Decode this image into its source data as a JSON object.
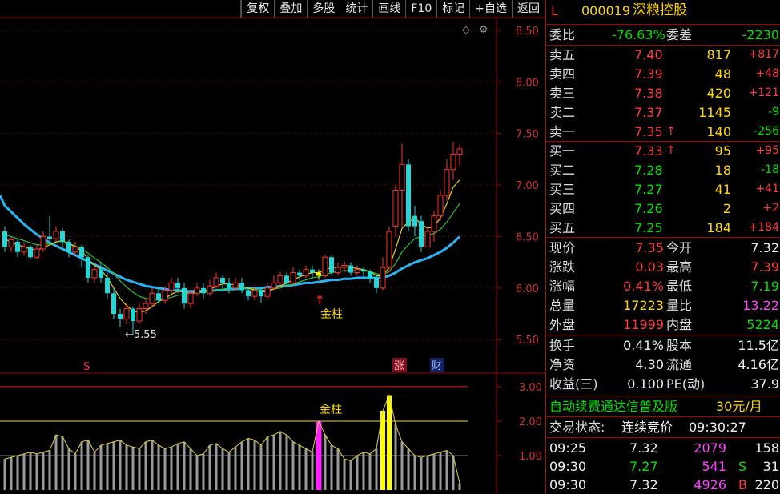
{
  "toolbar": [
    "复权",
    "叠加",
    "多股",
    "统计",
    "画线",
    "F10",
    "标记",
    "+自选",
    "返回"
  ],
  "stock": {
    "flag": "L",
    "code": "000019",
    "name": "深粮控股"
  },
  "webi": {
    "label": "委比",
    "value": "-76.63%",
    "label2": "委差",
    "value2": "-2230"
  },
  "sells": [
    {
      "label": "卖五",
      "price": "7.40",
      "vol": "817",
      "chg": "+817"
    },
    {
      "label": "卖四",
      "price": "7.39",
      "vol": "48",
      "chg": "+48"
    },
    {
      "label": "卖三",
      "price": "7.38",
      "vol": "420",
      "chg": "+121"
    },
    {
      "label": "卖二",
      "price": "7.37",
      "vol": "1145",
      "chg": "-9"
    },
    {
      "label": "卖一",
      "price": "7.35",
      "vol": "140",
      "chg": "-256",
      "arrow": "↑"
    }
  ],
  "buys": [
    {
      "label": "买一",
      "price": "7.33",
      "vol": "95",
      "chg": "+95",
      "arrow": "↑"
    },
    {
      "label": "买二",
      "price": "7.28",
      "vol": "18",
      "chg": "-18"
    },
    {
      "label": "买三",
      "price": "7.27",
      "vol": "41",
      "chg": "+41"
    },
    {
      "label": "买四",
      "price": "7.26",
      "vol": "2",
      "chg": "+2"
    },
    {
      "label": "买五",
      "price": "7.25",
      "vol": "184",
      "chg": "+184"
    }
  ],
  "quote": [
    {
      "l1": "现价",
      "v1": "7.35",
      "c1": "red",
      "l2": "今开",
      "v2": "7.32",
      "c2": "white"
    },
    {
      "l1": "涨跌",
      "v1": "0.03",
      "c1": "red",
      "l2": "最高",
      "v2": "7.39",
      "c2": "red"
    },
    {
      "l1": "涨幅",
      "v1": "0.41%",
      "c1": "red",
      "l2": "最低",
      "v2": "7.19",
      "c2": "green"
    },
    {
      "l1": "总量",
      "v1": "17223",
      "c1": "yellow",
      "l2": "量比",
      "v2": "13.22",
      "c2": "mag"
    },
    {
      "l1": "外盘",
      "v1": "11999",
      "c1": "red",
      "l2": "内盘",
      "v2": "5224",
      "c2": "green"
    }
  ],
  "fund": [
    {
      "l1": "换手",
      "v1": "0.41%",
      "l2": "股本",
      "v2": "11.5亿"
    },
    {
      "l1": "净资",
      "v1": "4.30",
      "l2": "流通",
      "v2": "4.16亿"
    },
    {
      "l1": "收益(三)",
      "v1": "0.100",
      "l2": "PE(动)",
      "v2": "37.9"
    }
  ],
  "ad": {
    "text": "自动续费通达信普及版",
    "price": "30元/月"
  },
  "trade_status": {
    "label": "交易状态:",
    "state": "连续竞价",
    "time": "09:30:27"
  },
  "ticks": [
    {
      "time": "09:25",
      "price": "7.32",
      "pc": "white",
      "vol": "2079",
      "flag": "",
      "tail": "158"
    },
    {
      "time": "09:30",
      "price": "7.27",
      "pc": "green",
      "vol": "541",
      "flag": "S",
      "tail": "31"
    },
    {
      "time": "09:30",
      "price": "7.32",
      "pc": "white",
      "vol": "4926",
      "flag": "B",
      "tail": "220"
    }
  ],
  "chart_labels": {
    "low_label": "←5.55",
    "gold1": "金柱",
    "gold2": "金柱",
    "s_mark": "S",
    "zhang": "涨",
    "cai": "财"
  },
  "price_axis": [
    "8.50",
    "8.00",
    "7.50",
    "7.00",
    "6.50",
    "6.00",
    "5.50"
  ],
  "ind_axis": [
    "3.00",
    "2.00",
    "1.00"
  ],
  "chart_data": {
    "type": "candlestick",
    "ylim": [
      5.3,
      8.6
    ],
    "candles": [
      [
        6.55,
        6.4,
        6.6,
        6.35
      ],
      [
        6.4,
        6.47,
        6.5,
        6.35
      ],
      [
        6.45,
        6.35,
        6.48,
        6.3
      ],
      [
        6.35,
        6.4,
        6.45,
        6.32
      ],
      [
        6.4,
        6.3,
        6.42,
        6.28
      ],
      [
        6.3,
        6.38,
        6.42,
        6.28
      ],
      [
        6.38,
        6.5,
        6.55,
        6.35
      ],
      [
        6.5,
        6.48,
        6.7,
        6.44
      ],
      [
        6.48,
        6.55,
        6.6,
        6.45
      ],
      [
        6.55,
        6.45,
        6.58,
        6.4
      ],
      [
        6.45,
        6.35,
        6.47,
        6.3
      ],
      [
        6.35,
        6.4,
        6.45,
        6.32
      ],
      [
        6.4,
        6.3,
        6.42,
        6.2
      ],
      [
        6.3,
        6.1,
        6.32,
        6.05
      ],
      [
        6.1,
        6.18,
        6.22,
        6.05
      ],
      [
        6.18,
        6.1,
        6.25,
        6.05
      ],
      [
        6.1,
        5.95,
        6.15,
        5.9
      ],
      [
        5.95,
        5.75,
        6.0,
        5.7
      ],
      [
        5.75,
        5.7,
        5.8,
        5.62
      ],
      [
        5.7,
        5.8,
        5.85,
        5.65
      ],
      [
        5.8,
        5.68,
        5.82,
        5.55
      ],
      [
        5.68,
        5.8,
        5.85,
        5.65
      ],
      [
        5.8,
        5.85,
        5.9,
        5.75
      ],
      [
        5.85,
        5.95,
        6.0,
        5.82
      ],
      [
        5.95,
        5.88,
        6.0,
        5.85
      ],
      [
        5.88,
        5.98,
        6.02,
        5.85
      ],
      [
        5.98,
        6.05,
        6.1,
        5.95
      ],
      [
        6.05,
        6.0,
        6.1,
        5.95
      ],
      [
        6.0,
        5.85,
        6.05,
        5.8
      ],
      [
        5.85,
        5.95,
        5.98,
        5.8
      ],
      [
        5.95,
        6.0,
        6.05,
        5.92
      ],
      [
        6.0,
        5.95,
        6.05,
        5.9
      ],
      [
        5.95,
        6.02,
        6.08,
        5.92
      ],
      [
        6.02,
        6.1,
        6.15,
        6.0
      ],
      [
        6.1,
        6.05,
        6.12,
        6.0
      ],
      [
        6.05,
        6.0,
        6.1,
        5.95
      ],
      [
        6.0,
        6.05,
        6.1,
        5.98
      ],
      [
        6.05,
        5.98,
        6.1,
        5.95
      ],
      [
        5.98,
        5.92,
        6.0,
        5.88
      ],
      [
        5.92,
        5.98,
        6.02,
        5.88
      ],
      [
        5.98,
        5.92,
        6.0,
        5.86
      ],
      [
        5.92,
        6.0,
        6.05,
        5.9
      ],
      [
        6.0,
        6.05,
        6.12,
        5.98
      ],
      [
        6.05,
        6.12,
        6.16,
        6.02
      ],
      [
        6.12,
        6.05,
        6.15,
        6.02
      ],
      [
        6.05,
        6.15,
        6.2,
        6.03
      ],
      [
        6.15,
        6.12,
        6.18,
        6.08
      ],
      [
        6.12,
        6.18,
        6.22,
        6.1
      ],
      [
        6.18,
        6.15,
        6.22,
        6.1
      ],
      [
        6.15,
        6.12,
        6.18,
        6.08
      ],
      [
        6.12,
        6.3,
        6.32,
        6.1
      ],
      [
        6.3,
        6.15,
        6.32,
        6.12
      ],
      [
        6.15,
        6.2,
        6.24,
        6.12
      ],
      [
        6.2,
        6.22,
        6.26,
        6.15
      ],
      [
        6.22,
        6.15,
        6.25,
        6.12
      ],
      [
        6.15,
        6.18,
        6.22,
        6.12
      ],
      [
        6.18,
        6.16,
        6.2,
        6.1
      ],
      [
        6.16,
        6.1,
        6.18,
        6.05
      ],
      [
        6.1,
        6.0,
        6.12,
        5.95
      ],
      [
        6.0,
        6.2,
        6.3,
        5.98
      ],
      [
        6.2,
        6.55,
        6.6,
        6.18
      ],
      [
        6.6,
        6.95,
        7.0,
        6.5
      ],
      [
        6.95,
        7.2,
        7.4,
        6.6
      ],
      [
        7.2,
        6.6,
        7.25,
        6.55
      ],
      [
        6.7,
        6.6,
        6.8,
        6.5
      ],
      [
        6.65,
        6.4,
        6.7,
        6.35
      ],
      [
        6.4,
        6.55,
        6.6,
        6.4
      ],
      [
        6.55,
        6.7,
        6.75,
        6.45
      ],
      [
        6.7,
        6.9,
        6.95,
        6.65
      ],
      [
        6.9,
        7.15,
        7.25,
        6.85
      ],
      [
        7.15,
        7.3,
        7.42,
        7.05
      ],
      [
        7.3,
        7.35,
        7.39,
        7.19
      ]
    ],
    "ma_short": [
      6.48,
      6.44,
      6.42,
      6.4,
      6.38,
      6.37,
      6.39,
      6.42,
      6.45,
      6.46,
      6.43,
      6.4,
      6.36,
      6.28,
      6.22,
      6.18,
      6.1,
      6.0,
      5.9,
      5.83,
      5.78,
      5.76,
      5.78,
      5.82,
      5.87,
      5.9,
      5.94,
      5.97,
      5.96,
      5.95,
      5.96,
      5.97,
      5.98,
      6.02,
      6.04,
      6.04,
      6.03,
      6.02,
      6.0,
      5.98,
      5.96,
      5.97,
      5.99,
      6.02,
      6.05,
      6.08,
      6.11,
      6.13,
      6.15,
      6.15,
      6.18,
      6.2,
      6.2,
      6.21,
      6.2,
      6.19,
      6.18,
      6.16,
      6.12,
      6.12,
      6.2,
      6.38,
      6.58,
      6.64,
      6.68,
      6.62,
      6.58,
      6.6,
      6.68,
      6.82,
      6.98,
      7.05
    ],
    "ma_mid": [
      6.52,
      6.5,
      6.48,
      6.46,
      6.44,
      6.42,
      6.42,
      6.43,
      6.44,
      6.44,
      6.43,
      6.41,
      6.38,
      6.34,
      6.29,
      6.25,
      6.2,
      6.14,
      6.07,
      6.01,
      5.96,
      5.92,
      5.9,
      5.89,
      5.89,
      5.9,
      5.91,
      5.93,
      5.94,
      5.95,
      5.95,
      5.96,
      5.97,
      5.98,
      5.99,
      6.0,
      6.0,
      6.0,
      6.0,
      5.99,
      5.98,
      5.98,
      5.99,
      6.0,
      6.02,
      6.04,
      6.06,
      6.08,
      6.1,
      6.11,
      6.13,
      6.15,
      6.16,
      6.17,
      6.17,
      6.17,
      6.17,
      6.16,
      6.14,
      6.13,
      6.16,
      6.24,
      6.35,
      6.42,
      6.48,
      6.5,
      6.51,
      6.53,
      6.57,
      6.64,
      6.73,
      6.82
    ],
    "ma_long": [
      6.8,
      6.74,
      6.68,
      6.62,
      6.57,
      6.52,
      6.48,
      6.44,
      6.41,
      6.38,
      6.35,
      6.32,
      6.29,
      6.26,
      6.23,
      6.2,
      6.17,
      6.14,
      6.11,
      6.08,
      6.06,
      6.04,
      6.02,
      6.01,
      6.0,
      5.99,
      5.98,
      5.98,
      5.97,
      5.97,
      5.97,
      5.97,
      5.97,
      5.98,
      5.98,
      5.99,
      5.99,
      6.0,
      6.0,
      6.0,
      6.0,
      6.01,
      6.01,
      6.02,
      6.02,
      6.03,
      6.04,
      6.05,
      6.05,
      6.06,
      6.07,
      6.08,
      6.08,
      6.09,
      6.09,
      6.1,
      6.1,
      6.1,
      6.1,
      6.1,
      6.12,
      6.15,
      6.19,
      6.22,
      6.25,
      6.27,
      6.29,
      6.32,
      6.35,
      6.39,
      6.44,
      6.5
    ],
    "indicator_ylim": [
      0,
      3.3
    ],
    "indicator": [
      0.9,
      0.95,
      1.0,
      1.05,
      1.1,
      1.05,
      1.1,
      1.15,
      1.6,
      1.55,
      1.2,
      1.05,
      1.4,
      1.45,
      1.1,
      1.3,
      1.35,
      1.4,
      1.45,
      1.3,
      1.25,
      1.2,
      1.4,
      1.45,
      1.3,
      1.2,
      1.25,
      1.35,
      1.4,
      1.2,
      1.0,
      1.05,
      1.3,
      1.35,
      1.2,
      1.1,
      1.25,
      1.4,
      1.5,
      1.45,
      1.3,
      1.55,
      1.6,
      1.7,
      1.6,
      1.4,
      1.3,
      1.2,
      1.1,
      2.0,
      1.6,
      1.3,
      1.2,
      0.9,
      0.85,
      1.0,
      1.1,
      1.05,
      1.2,
      2.3,
      2.75,
      1.9,
      1.4,
      1.2,
      1.0,
      0.95,
      1.0,
      1.05,
      1.1,
      1.15,
      1.0,
      0.2
    ],
    "gold_bars": [
      49,
      59,
      60
    ]
  }
}
